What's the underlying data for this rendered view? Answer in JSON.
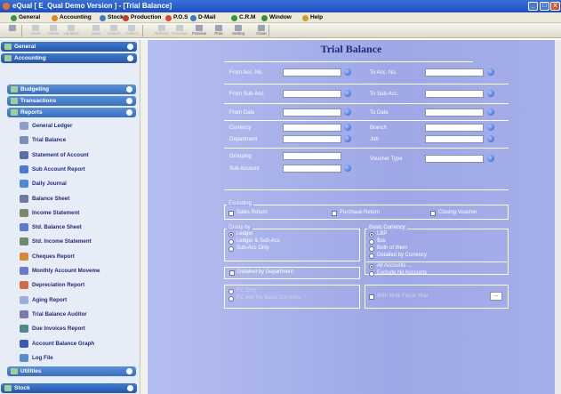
{
  "window": {
    "title": "eQual [ E_Qual Demo Version ] - [Trial Balance]",
    "min": "_",
    "max": "□",
    "close": "x"
  },
  "menu": [
    "General",
    "Accounting",
    "Stock",
    "Production",
    "P.O.S",
    "D-Mail",
    "C.R.M",
    "Window",
    "Help"
  ],
  "menu_colors": [
    "#2c9c3a",
    "#d98a1c",
    "#3a7cc0",
    "#c0392b",
    "#d24a2a",
    "#3a7cc0",
    "#2c9c3a",
    "#3a8c3a",
    "#d0a020"
  ],
  "toolbar": {
    "items": [
      "",
      "Insert",
      "Delete",
      "Updated",
      "Save",
      "Cancel",
      "Collect",
      "Refresh",
      "Previous",
      "Preview",
      "Print",
      "Setting",
      "Close"
    ]
  },
  "sidebar": {
    "general": "General",
    "accounting": "Accounting",
    "budgeting": "Budgeting",
    "transactions": "Transactions",
    "reports": "Reports",
    "items": [
      "General Ledger",
      "Trial Balance",
      "Statement of Account",
      "Sub Account Report",
      "Daily Journal",
      "Balance Sheet",
      "Income Statement",
      "Std. Balance Sheet",
      "Std. Income Statement",
      "Cheques Report",
      "Monthly Account Moveme",
      "Depreciation Report",
      "Aging Report",
      "Trial Balance Auditor",
      "Due Invoices Report",
      "Account Balance Graph",
      "Log File"
    ],
    "item_colors": [
      "#8aa0c8",
      "#7a8fb8",
      "#5a6ea8",
      "#4a7ad0",
      "#4a8ad8",
      "#6a7a9a",
      "#7a8a6a",
      "#5a7ad0",
      "#6a8a6a",
      "#d08a3a",
      "#6a7ac8",
      "#d06a4a",
      "#9ab0d8",
      "#7a7aa8",
      "#4a8a8a",
      "#3a5ab8",
      "#5a8ad0"
    ],
    "utilities": "Utilities",
    "stock": "Stock"
  },
  "form": {
    "title": "Trial Balance",
    "from_acc_no": "From Acc. No.",
    "to_acc_no": "To Acc. No.",
    "from_sub_acc": "From Sub-Acc.",
    "to_sub_acc": "To Sub-Acc.",
    "from_date": "From Date",
    "to_date": "To Date",
    "currency": "Currency",
    "branch": "Branch",
    "department": "Department",
    "job": "Job",
    "grouping": "Grouping",
    "voucher_type": "Voucher Type",
    "sub_account": "Sub Account",
    "excluding": {
      "title": "Excluding",
      "sales_return": "Sales Return",
      "purchase_return": "Purchase Return",
      "closing_voucher": "Closing Voucher"
    },
    "group_by": {
      "title": "Group by",
      "options": [
        "Ledger",
        "Ledger & Sub-Acc",
        "Sub-Acc Only"
      ],
      "selected": "Ledger"
    },
    "basic_currency": {
      "title": "Basic Currency",
      "options": [
        "LBP",
        "$us",
        "Both of them",
        "Detailed by Currency"
      ],
      "selected": "LBP"
    },
    "accounts": {
      "options": [
        "All Accounts ...",
        "Exclude Nil Accounts"
      ],
      "selected": "All Accounts ..."
    },
    "detailed_by_department": "Detailed by Department",
    "fc": {
      "options": [
        "FC Only",
        "FC with his Basic Currency"
      ]
    },
    "with_multi_fiscal_year": "With Multi Fiscal Year",
    "dots": "..."
  }
}
